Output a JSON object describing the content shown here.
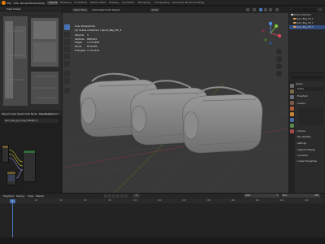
{
  "menu": {
    "items": [
      "File",
      "Edit",
      "Render",
      "Window",
      "Help"
    ],
    "workspaces": [
      "Layout",
      "Modeling",
      "UV Editing",
      "Texture Paint",
      "Shading",
      "Animation",
      "Rendering",
      "Compositing",
      "Geometry Nodes",
      "Scripting"
    ],
    "active_workspace": "Layout"
  },
  "viewport": {
    "mode": "Object Mode",
    "menus": [
      "View",
      "Select",
      "Add",
      "Object"
    ],
    "transform": "Global",
    "overlay": {
      "view": "User Perspective",
      "collection": "(1) Scene Collection | Sport_Bag_HP_3",
      "stats": [
        {
          "label": "Objects",
          "value": "3"
        },
        {
          "label": "Vertices",
          "value": "898,901"
        },
        {
          "label": "Edges",
          "value": "1,773,900"
        },
        {
          "label": "Faces",
          "value": "874,226"
        },
        {
          "label": "Triangles",
          "value": "1,779,124"
        }
      ]
    }
  },
  "outliner": {
    "title": "Scene Collection",
    "items": [
      "Sport_Bag_HP_1",
      "Sport_Bag_HP_2",
      "Sport_Bag_HP_3"
    ],
    "selected_index": 2
  },
  "properties": {
    "header": "Scene",
    "object": "Scene",
    "panels": [
      "Transform",
      "Surface",
      "Volume",
      "Ray Visibility",
      "Settings",
      "Viewport Display",
      "Animation",
      "Custom Properties"
    ]
  },
  "node_editor": {
    "object_menu": "Object",
    "menus": [
      "View",
      "Select",
      "Add",
      "Node"
    ],
    "use_nodes": "Use Nodes",
    "slot": "Slot 1",
    "material": "Sport_bag_gym_bag_tidelight_m"
  },
  "image_editor": {
    "menus": [
      "View",
      "Image"
    ]
  },
  "timeline": {
    "menus": [
      "Playback",
      "Keying",
      "View",
      "Marker"
    ],
    "current_frame": "1",
    "ticks": [
      "0",
      "10",
      "20",
      "30",
      "40",
      "50",
      "60",
      "70",
      "80",
      "90",
      "100",
      "110",
      "120",
      "130",
      "140",
      "150",
      "160",
      "170",
      "180",
      "190",
      "200",
      "210",
      "220",
      "230",
      "240",
      "250"
    ],
    "start_label": "Start",
    "start": "1",
    "end_label": "End",
    "end": "250"
  },
  "colors": {
    "accent": "#4772b3",
    "selection": "#334d80",
    "logo": "#e87d0d",
    "axis_x": "#e0455a",
    "axis_y": "#7ec43b",
    "axis_z": "#4f8fe6"
  }
}
